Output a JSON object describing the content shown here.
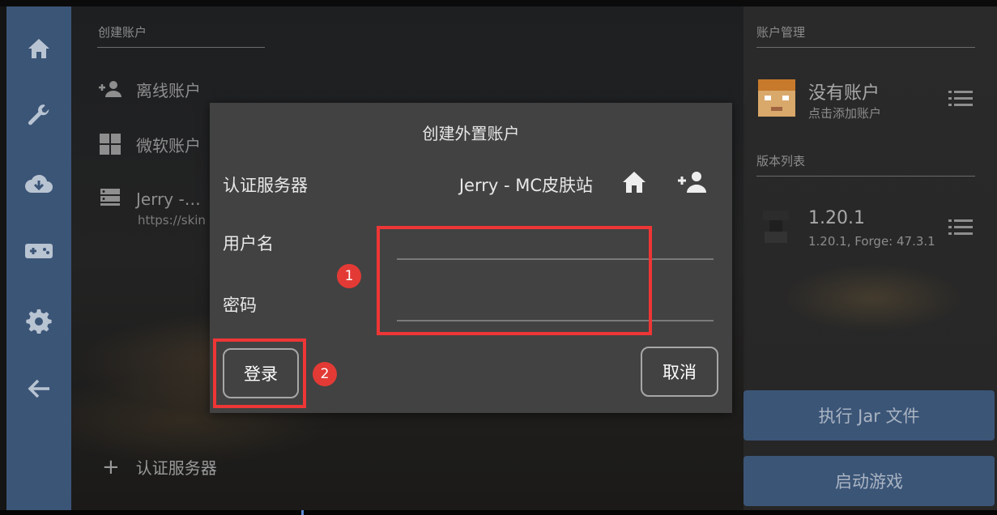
{
  "nav": {
    "items": [
      {
        "icon": "home-icon"
      },
      {
        "icon": "wrench-icon"
      },
      {
        "icon": "cloud-download-icon"
      },
      {
        "icon": "gamepad-icon"
      },
      {
        "icon": "gear-icon"
      },
      {
        "icon": "arrow-left-icon"
      }
    ]
  },
  "accounts_panel": {
    "section_label": "创建账户",
    "offline_label": "离线账户",
    "microsoft_label": "微软账户",
    "server_name": "Jerry -…",
    "server_url": "https://skin",
    "add_server_label": "认证服务器"
  },
  "right_panel": {
    "account_section": "账户管理",
    "account_title": "没有账户",
    "account_subtitle": "点击添加账户",
    "version_section": "版本列表",
    "version_title": "1.20.1",
    "version_subtitle": "1.20.1, Forge: 47.3.1",
    "run_jar_label": "执行 Jar 文件",
    "launch_label": "启动游戏"
  },
  "dialog": {
    "title": "创建外置账户",
    "server_label": "认证服务器",
    "server_value": "Jerry - MC皮肤站",
    "username_label": "用户名",
    "username_value": "",
    "password_label": "密码",
    "password_value": "",
    "login_label": "登录",
    "cancel_label": "取消"
  },
  "annotations": {
    "badge1": "1",
    "badge2": "2",
    "color": "#ee3636"
  },
  "colors": {
    "rail": "#3b5577",
    "dialog_bg": "#424242",
    "accent_button": "#3b5577"
  }
}
